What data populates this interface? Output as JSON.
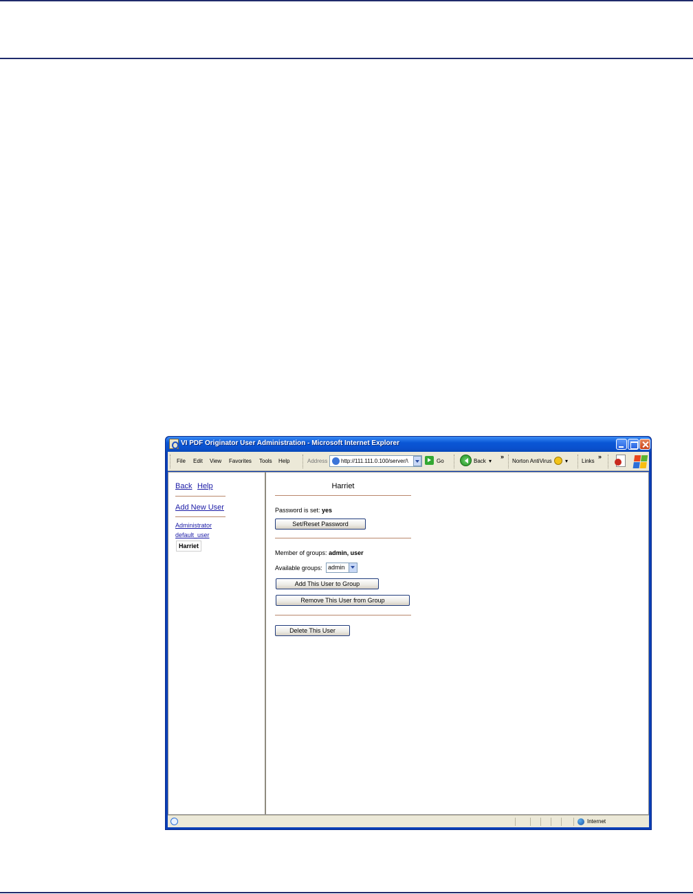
{
  "window": {
    "title": "VI PDF Originator User Administration - Microsoft Internet Explorer"
  },
  "menu": [
    "File",
    "Edit",
    "View",
    "Favorites",
    "Tools",
    "Help"
  ],
  "toolbar": {
    "address_label": "Address",
    "address_value": "http://111.111.0.100/server/\\",
    "go_label": "Go",
    "back_label": "Back",
    "norton_label": "Norton AntiVirus",
    "links_label": "Links",
    "chevron": "»"
  },
  "sidebar": {
    "back_link": "Back",
    "help_link": "Help",
    "add_user_link": "Add New User",
    "users": [
      "Administrator",
      "default_user"
    ],
    "current_user": "Harriet"
  },
  "main": {
    "user_title": "Harriet",
    "password_label": "Password is set:",
    "password_value": "yes",
    "set_password_button": "Set/Reset Password",
    "groups_label": "Member of groups:",
    "groups_value": "admin, user",
    "available_groups_label": "Available groups:",
    "available_groups_selected": "admin",
    "add_to_group_button": "Add This User to Group",
    "remove_from_group_button": "Remove This User from Group",
    "delete_user_button": "Delete This User"
  },
  "statusbar": {
    "zone": "Internet"
  },
  "colors": {
    "titlebar": "#0a57d6",
    "link": "#1a1aa6",
    "separator": "#b8866a",
    "page_rules": "#1f2a6b"
  }
}
